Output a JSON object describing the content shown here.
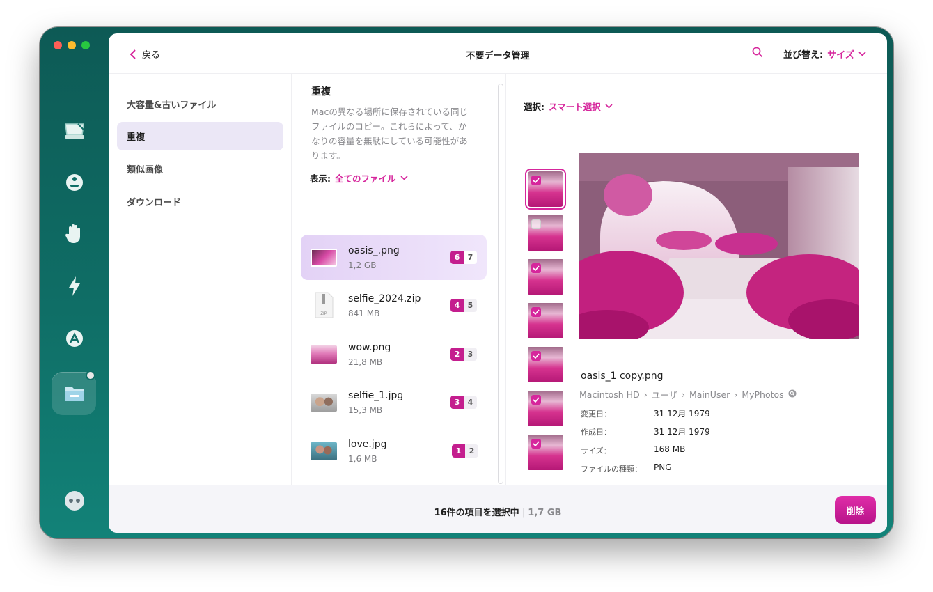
{
  "header": {
    "back_label": "戻る",
    "title": "不要データ管理",
    "sort_label": "並び替え:",
    "sort_value": "サイズ"
  },
  "sidebar": {
    "items": [
      {
        "label": "大容量&古いファイル"
      },
      {
        "label": "重複",
        "selected": true
      },
      {
        "label": "類似画像"
      },
      {
        "label": "ダウンロード"
      }
    ]
  },
  "middle": {
    "title": "重複",
    "description": "Macの異なる場所に保存されている同じファイルのコピー。これらによって、かなりの容量を無駄にしている可能性があります。",
    "filter_label": "表示:",
    "filter_value": "全てのファイル",
    "files": [
      {
        "name": "oasis_.png",
        "size": "1,2 GB",
        "selected_count": "6",
        "total_count": "7"
      },
      {
        "name": "selfie_2024.zip",
        "size": "841 MB",
        "selected_count": "4",
        "total_count": "5"
      },
      {
        "name": "wow.png",
        "size": "21,8 MB",
        "selected_count": "2",
        "total_count": "3"
      },
      {
        "name": "selfie_1.jpg",
        "size": "15,3 MB",
        "selected_count": "3",
        "total_count": "4"
      },
      {
        "name": "love.jpg",
        "size": "1,6 MB",
        "selected_count": "1",
        "total_count": "2"
      }
    ]
  },
  "detail": {
    "select_label": "選択:",
    "select_value": "スマート選択",
    "thumbnails_checked": [
      true,
      false,
      true,
      true,
      true,
      true,
      true
    ],
    "file_name": "oasis_1 copy.png",
    "path": [
      "Macintosh HD",
      "ユーザ",
      "MainUser",
      "MyPhotos"
    ],
    "meta": [
      {
        "label": "変更日：",
        "value": "31 12月 1979"
      },
      {
        "label": "作成日：",
        "value": "31 12月 1979"
      },
      {
        "label": "サイズ：",
        "value": "168 MB"
      },
      {
        "label": "ファイルの種類：",
        "value": "PNG"
      }
    ]
  },
  "footer": {
    "status": "16件の項目を選択中",
    "total_size": "1,7 GB",
    "delete_label": "削除"
  },
  "colors": {
    "accent": "#d6269c",
    "window_bg": "#0f6e66"
  }
}
